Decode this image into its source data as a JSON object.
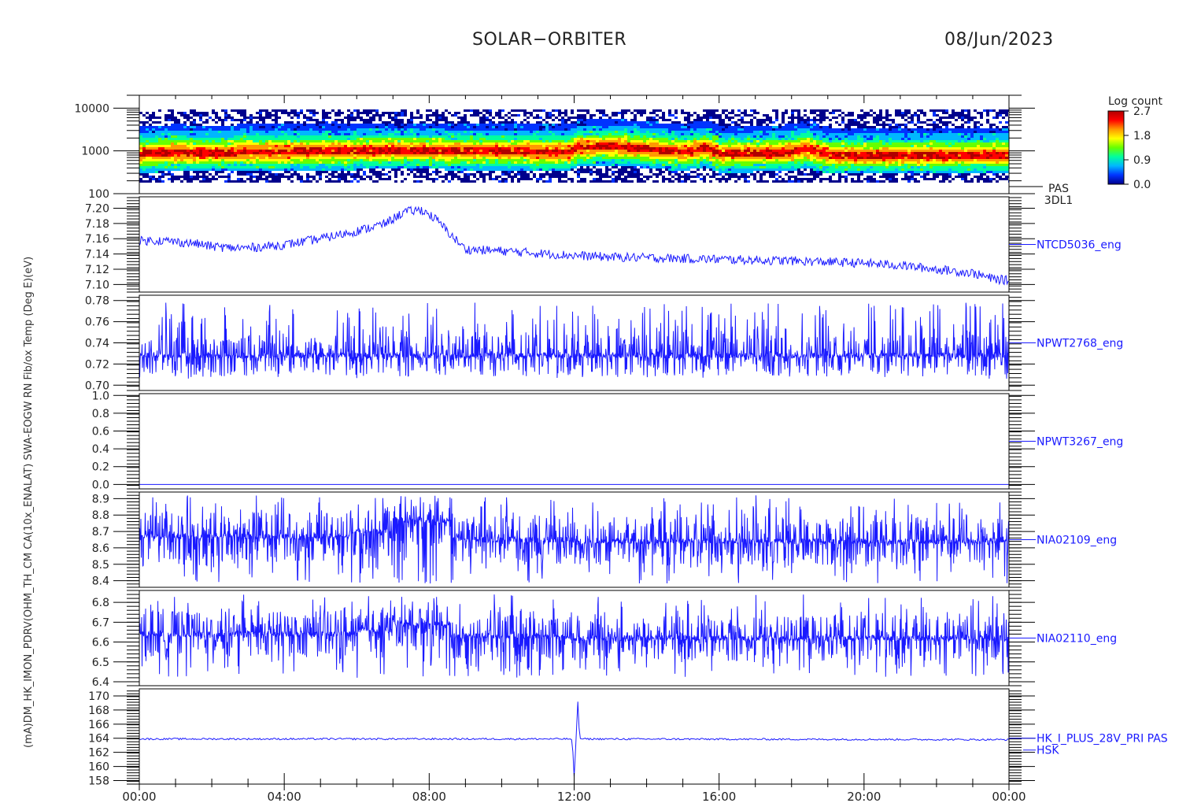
{
  "header": {
    "mission": "SOLAR−ORBITER",
    "date": "08/Jun/2023"
  },
  "x_axis": {
    "ticks": [
      "00:00",
      "04:00",
      "08:00",
      "12:00",
      "16:00",
      "20:00",
      "00:00"
    ],
    "range_hours": [
      0,
      24
    ]
  },
  "left_axis_title": "(mA)DM_HK_IMON_PDRV(OHM_TH_CM CA(10x_ENALAT)  SWA-EOGW RN Fib/ox Temp (Deg E)(eV)",
  "colors": {
    "trace": "#1a1aff",
    "label": "#1a1aff",
    "frame": "#000000"
  },
  "colorbar": {
    "title": "Log count",
    "ticks": [
      "2.7",
      "1.8",
      "0.9",
      "0.0"
    ],
    "range": [
      0.0,
      2.7
    ],
    "colors": [
      "#00008c",
      "#0033ff",
      "#00b7ff",
      "#00ff9f",
      "#66ff00",
      "#ffff00",
      "#ff9900",
      "#ff0000",
      "#b00000"
    ]
  },
  "chart_data": [
    {
      "type": "heatmap",
      "label": "PAS\n3DL1",
      "label_lines": [
        "PAS",
        "3DL1"
      ],
      "y_scale": "log",
      "ylim": [
        100,
        20000
      ],
      "y_ticks": [
        "10000",
        "1000",
        "100"
      ],
      "peak_energy_eV": {
        "x_hours": [
          0,
          1,
          1.8,
          3,
          5,
          7,
          8,
          10,
          11.8,
          12.1,
          13,
          15,
          15.6,
          16,
          18,
          18.3,
          19,
          21,
          23,
          24
        ],
        "y": [
          900,
          1000,
          950,
          1000,
          1050,
          1100,
          1080,
          1050,
          1000,
          1300,
          1350,
          1000,
          1250,
          900,
          1000,
          1200,
          850,
          850,
          850,
          850
        ]
      }
    },
    {
      "type": "line",
      "label": "NTCD5036_eng",
      "ylim": [
        7.09,
        7.215
      ],
      "y_ticks": [
        "7.20",
        "7.18",
        "7.16",
        "7.14",
        "7.12",
        "7.10"
      ],
      "y_tick_values": [
        7.2,
        7.18,
        7.16,
        7.14,
        7.12,
        7.1
      ],
      "x_hours": [
        0,
        0.5,
        1.0,
        1.5,
        2.0,
        2.5,
        3.0,
        4.0,
        5.0,
        6.0,
        6.8,
        7.3,
        7.8,
        8.2,
        8.6,
        9.0,
        10.0,
        11.0,
        12.0,
        13.0,
        14.0,
        16.0,
        18.0,
        20.0,
        21.0,
        22.0,
        23.0,
        23.5,
        24.0
      ],
      "values": [
        7.157,
        7.158,
        7.156,
        7.154,
        7.15,
        7.148,
        7.148,
        7.152,
        7.16,
        7.17,
        7.18,
        7.195,
        7.198,
        7.185,
        7.165,
        7.146,
        7.144,
        7.141,
        7.138,
        7.136,
        7.135,
        7.133,
        7.131,
        7.128,
        7.125,
        7.12,
        7.115,
        7.108,
        7.105
      ]
    },
    {
      "type": "line",
      "label": "NPWT2768_eng",
      "ylim": [
        0.695,
        0.785
      ],
      "y_ticks": [
        "0.78",
        "0.76",
        "0.74",
        "0.72",
        "0.70"
      ],
      "y_tick_values": [
        0.78,
        0.76,
        0.74,
        0.72,
        0.7
      ],
      "baseline": 0.728,
      "noise_range": [
        0.706,
        0.778
      ]
    },
    {
      "type": "line",
      "label": "NPWT3267_eng",
      "ylim": [
        -0.05,
        1.02
      ],
      "y_ticks": [
        "1.0",
        "0.8",
        "0.6",
        "0.4",
        "0.2",
        "0.0"
      ],
      "y_tick_values": [
        1.0,
        0.8,
        0.6,
        0.4,
        0.2,
        0.0
      ],
      "baseline": 0.0
    },
    {
      "type": "line",
      "label": "NIA02109_eng",
      "ylim": [
        8.36,
        8.94
      ],
      "y_ticks": [
        "8.9",
        "8.8",
        "8.7",
        "8.6",
        "8.5",
        "8.4"
      ],
      "y_tick_values": [
        8.9,
        8.8,
        8.7,
        8.6,
        8.5,
        8.4
      ],
      "baseline_segments": {
        "x_hours": [
          0,
          5.8,
          7.0,
          8.6,
          12.0,
          24.0
        ],
        "y": [
          8.67,
          8.7,
          8.77,
          8.65,
          8.64,
          8.62
        ]
      },
      "noise_range": [
        8.38,
        8.92
      ]
    },
    {
      "type": "line",
      "label": "NIA02110_eng",
      "ylim": [
        6.38,
        6.86
      ],
      "y_ticks": [
        "6.8",
        "6.7",
        "6.6",
        "6.5",
        "6.4"
      ],
      "y_tick_values": [
        6.8,
        6.7,
        6.6,
        6.5,
        6.4
      ],
      "baseline_segments": {
        "x_hours": [
          0,
          6.0,
          7.0,
          8.6,
          12.0,
          24.0
        ],
        "y": [
          6.64,
          6.66,
          6.69,
          6.63,
          6.62,
          6.59
        ]
      },
      "noise_range": [
        6.42,
        6.84
      ]
    },
    {
      "type": "line",
      "label": "HK_I_PLUS_28V_PRI PAS\nHSK",
      "label_lines": [
        "HK_I_PLUS_28V_PRI PAS",
        "HSK"
      ],
      "ylim": [
        157.5,
        171
      ],
      "y_ticks": [
        "170",
        "168",
        "166",
        "164",
        "162",
        "160",
        "158"
      ],
      "y_tick_values": [
        170,
        168,
        166,
        164,
        162,
        160,
        158
      ],
      "x_hours": [
        0,
        11.9,
        11.95,
        12.0,
        12.05,
        12.1,
        12.15,
        12.2,
        24.0
      ],
      "values": [
        163.9,
        163.9,
        163.7,
        158.5,
        163.5,
        169.5,
        164.0,
        163.9,
        163.8
      ]
    }
  ]
}
